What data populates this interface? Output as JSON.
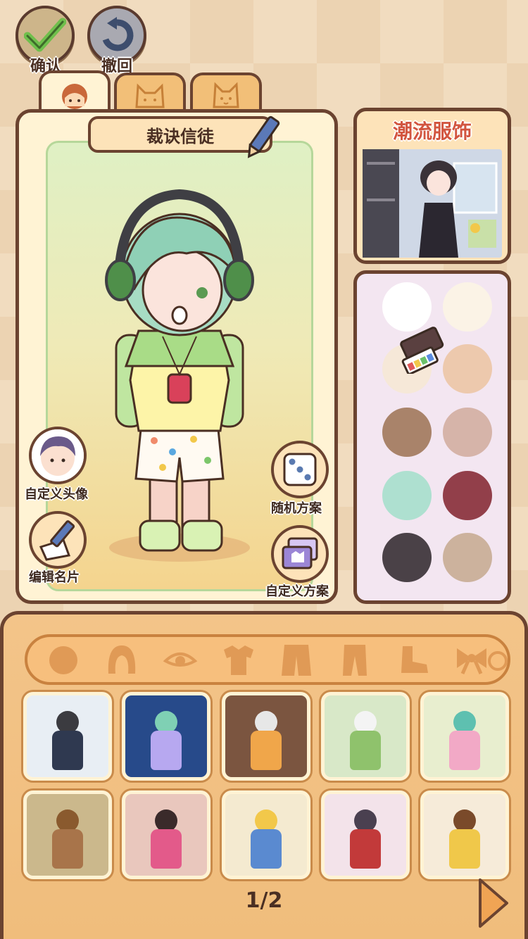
{
  "top_buttons": {
    "confirm": "确认",
    "undo": "撤回"
  },
  "character": {
    "name": "裁诀信徒"
  },
  "side_actions": {
    "custom_avatar": "自定义头像",
    "edit_card": "编辑名片",
    "random_plan": "随机方案",
    "custom_plan": "自定义方案"
  },
  "shop": {
    "title": "潮流服饰"
  },
  "palette": {
    "colors": [
      "#ffffff",
      "#fbf3e6",
      "#f6e8d8",
      "#edc9ad",
      "#a9836a",
      "#d6b4a9",
      "#aee0d0",
      "#923f4a",
      "#4a4147",
      "#ccb29d"
    ]
  },
  "outfits_row1": [
    "#e8eef4",
    "#274a8a",
    "#7b5540",
    "#d8e8c8",
    "#e8eecf"
  ],
  "outfits_row2": [
    "#cbb88c",
    "#e9c7bd",
    "#f4ead0",
    "#f3e3ea",
    "#f6ebd9"
  ],
  "pagination": {
    "label": "1/2"
  }
}
